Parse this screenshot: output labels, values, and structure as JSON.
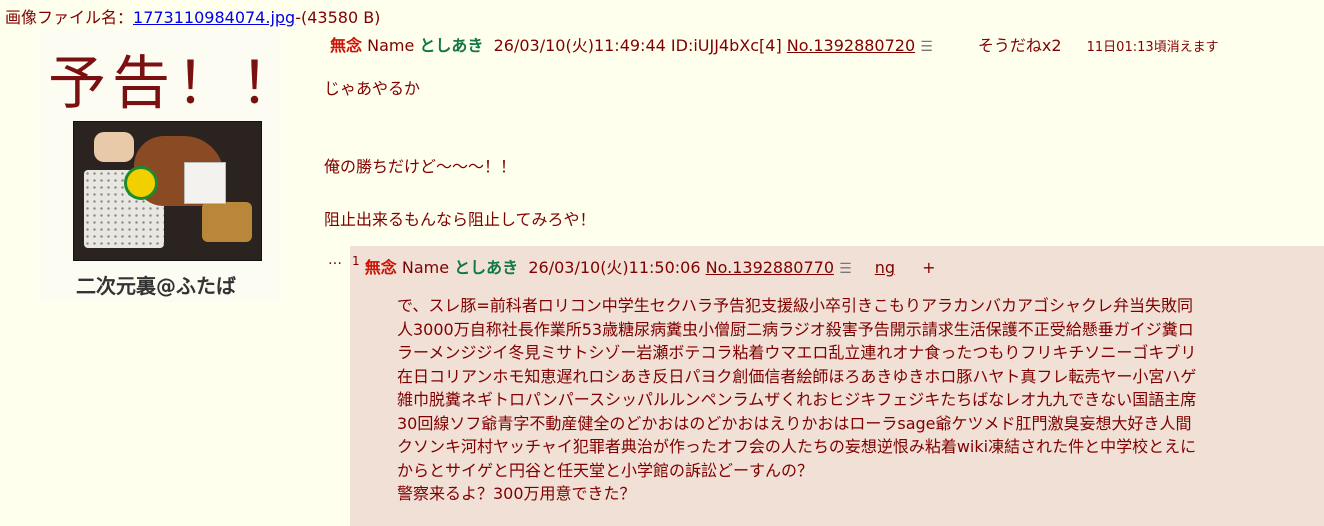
{
  "file_info": {
    "label": "画像ファイル名：",
    "filename": "1773110984074.jpg",
    "size": "-(43580 B)"
  },
  "thumbnail": {
    "title_text": "予告！！",
    "caption_text": "二次元裏@ふたば"
  },
  "post": {
    "subject": "無念",
    "name_label": "Name",
    "name": "としあき",
    "datetime": "26/03/10(火)11:49:44",
    "id": "ID:iUJJ4bXc[4]",
    "number": "No.1392880720",
    "menu_icon": "list-menu-icon",
    "sodane": "そうだねx2",
    "expiry": "11日01:13頃消えます",
    "body": [
      "じゃあやるか",
      "俺の勝ちだけど〜〜〜！！",
      "阻止出来るもんなら阻止してみろや！"
    ]
  },
  "reply": {
    "dots": "…",
    "serial": "1",
    "subject": "無念",
    "name_label": "Name",
    "name": "としあき",
    "datetime": "26/03/10(火)11:50:06",
    "number": "No.1392880770",
    "ng": "ng",
    "plus": "+",
    "body_lines": [
      "で、スレ豚=前科者ロリコン中学生セクハラ予告犯支援級小卒引きこもりアラカンバカアゴシャクレ弁当失敗同",
      "人3000万自称社長作業所53歳糖尿病糞虫小僧厨二病ラジオ殺害予告開示請求生活保護不正受給懸垂ガイジ糞ロ",
      "ラーメンジジイ冬見ミサトシゾー岩瀬ボテコラ粘着ウマエロ乱立連れオナ食ったつもりフリキチソニーゴキブリ",
      "在日コリアンホモ知恵遅れロシあき反日パヨク創価信者絵師ほろあきゆきホロ豚ハヤト真フレ転売ヤー小宮ハゲ",
      "雑巾脱糞ネギトロパンパースシッパルルンペンラムザくれおヒジキフェジキたちばなレオ九九できない国語主席",
      "30回線ソフ爺青字不動産健全のどかおはのどかおはえりかおはローラsage爺ケツメド肛門激臭妄想大好き人間",
      "クソンキ河村ヤッチャイ犯罪者典治が作ったオフ会の人たちの妄想逆恨み粘着wiki凍結された件と中学校とえに",
      "からとサイゲと円谷と任天堂と小学館の訴訟どーすんの？",
      "警察来るよ？300万用意できた？"
    ]
  }
}
